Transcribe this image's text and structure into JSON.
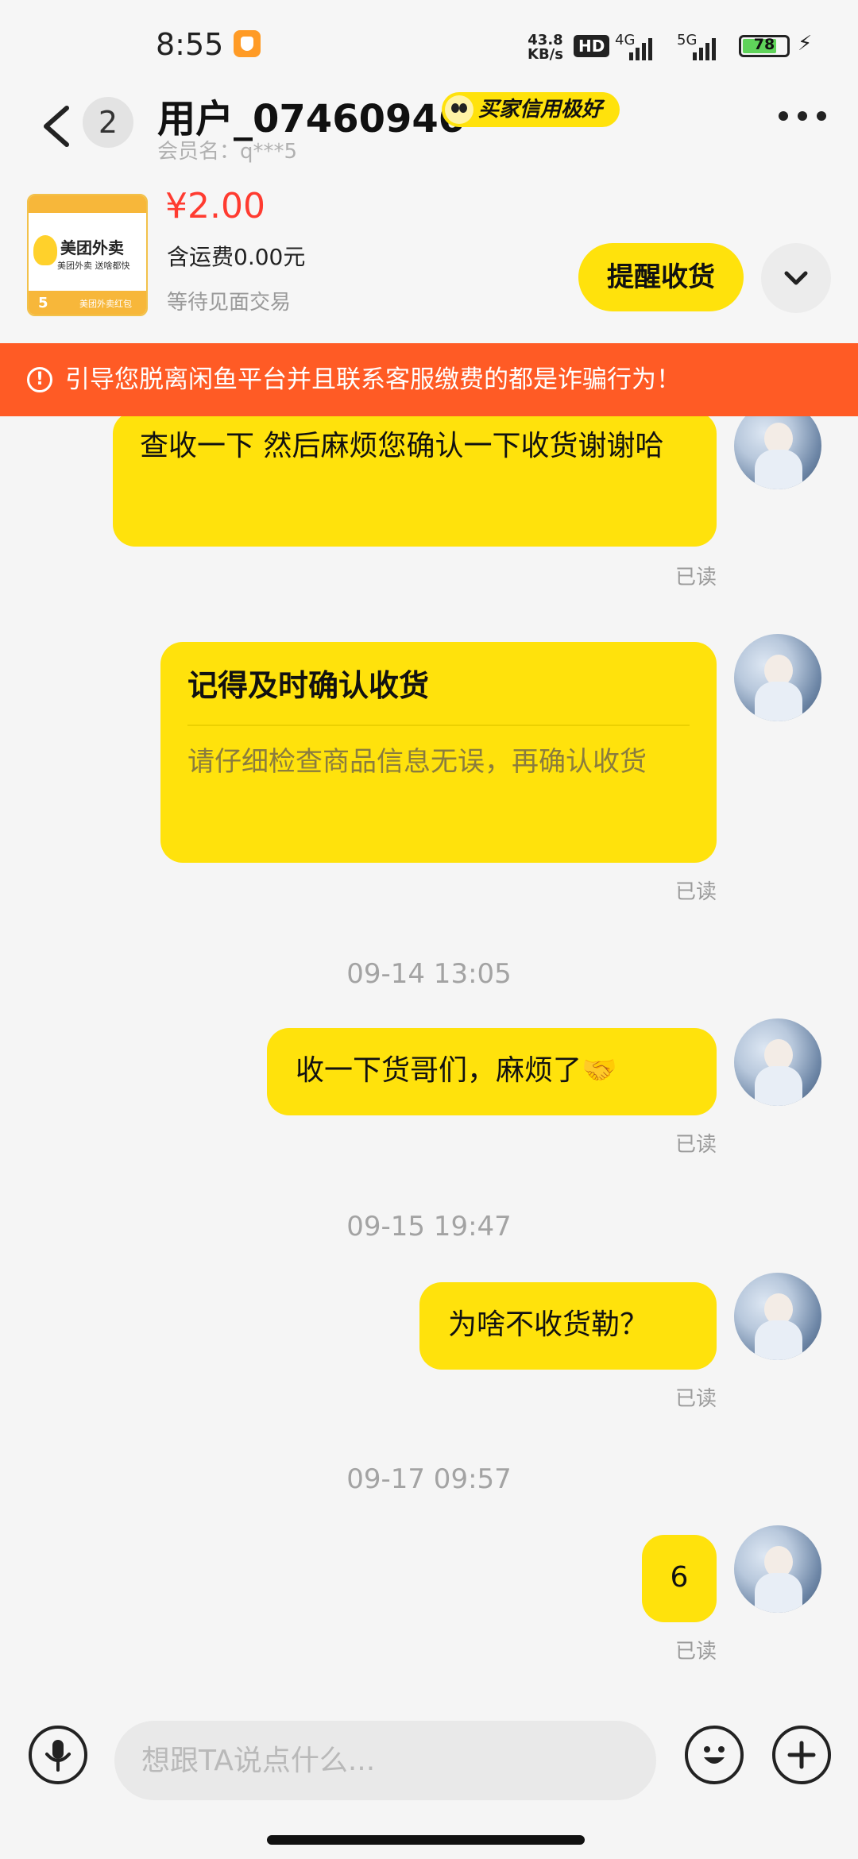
{
  "status_bar": {
    "time": "8:55",
    "speed_value": "43.8",
    "speed_unit": "KB/s",
    "hd_label": "HD",
    "net_a": "4G",
    "net_b": "5G",
    "battery": "78",
    "battery_level": 0.78
  },
  "header": {
    "unread_count": "2",
    "title": "用户_07460946",
    "credit_badge": "买家信用极好",
    "member_label": "会员名：q***5"
  },
  "product": {
    "thumb_brand": "美团外卖",
    "thumb_slogan": "美团外卖 送啥都快",
    "thumb_num": "5",
    "thumb_bottom": "美团外卖红包",
    "price": "¥2.00",
    "shipping": "含运费0.00元",
    "status": "等待见面交易",
    "remind_label": "提醒收货"
  },
  "warning": {
    "text": "引导您脱离闲鱼平台并且联系客服缴费的都是诈骗行为！"
  },
  "messages": {
    "m1": {
      "text": "查收一下 然后麻烦您确认一下收货谢谢哈",
      "read": "已读"
    },
    "m2": {
      "title": "记得及时确认收货",
      "desc": "请仔细检查商品信息无误，再确认收货",
      "read": "已读"
    },
    "t1": "09-14 13:05",
    "m3": {
      "text": "收一下货哥们，麻烦了🤝",
      "read": "已读"
    },
    "t2": "09-15 19:47",
    "m4": {
      "text": "为啥不收货勒？",
      "read": "已读"
    },
    "t3": "09-17 09:57",
    "m5": {
      "text": "6",
      "read": "已读"
    }
  },
  "input": {
    "placeholder": "想跟TA说点什么...",
    "value": ""
  },
  "colors": {
    "accent": "#ffe20c",
    "warning": "#ff5b25",
    "price": "#ff3b30"
  },
  "icons": [
    "back-icon",
    "more-icon",
    "chevron-down-icon",
    "warning-icon",
    "microphone-icon",
    "emoji-icon",
    "plus-icon"
  ]
}
